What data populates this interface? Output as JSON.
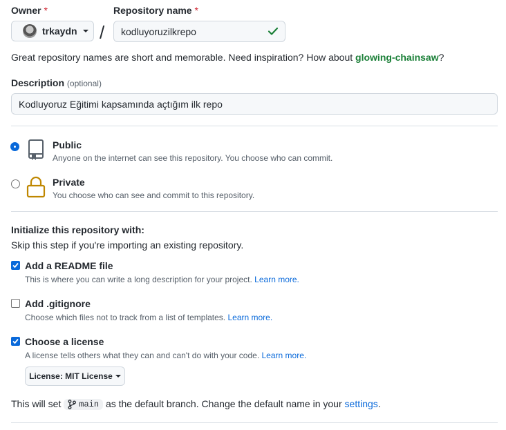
{
  "owner": {
    "label": "Owner",
    "required_mark": "*",
    "username": "trkaydn"
  },
  "repo": {
    "label": "Repository name",
    "required_mark": "*",
    "value": "kodluyoruzilkrepo",
    "separator": "/"
  },
  "name_hint": {
    "text": "Great repository names are short and memorable. Need inspiration? How about ",
    "suggestion": "glowing-chainsaw",
    "suffix": "?"
  },
  "description": {
    "label": "Description",
    "optional": "(optional)",
    "value": "Kodluyoruz Eğitimi kapsamında açtığım ilk repo"
  },
  "visibility": {
    "public": {
      "title": "Public",
      "desc": "Anyone on the internet can see this repository. You choose who can commit.",
      "selected": true
    },
    "private": {
      "title": "Private",
      "desc": "You choose who can see and commit to this repository.",
      "selected": false
    }
  },
  "init": {
    "heading": "Initialize this repository with:",
    "subheading": "Skip this step if you're importing an existing repository.",
    "readme": {
      "title": "Add a README file",
      "desc": "This is where you can write a long description for your project.",
      "link": "Learn more.",
      "checked": true
    },
    "gitignore": {
      "title": "Add .gitignore",
      "desc": "Choose which files not to track from a list of templates.",
      "link": "Learn more.",
      "checked": false
    },
    "license": {
      "title": "Choose a license",
      "desc": "A license tells others what they can and can't do with your code.",
      "link": "Learn more.",
      "checked": true,
      "button": "License: MIT License"
    }
  },
  "branch_note": {
    "prefix": "This will set",
    "branch": "main",
    "middle": "as the default branch. Change the default name in your",
    "link": "settings",
    "suffix": "."
  },
  "colors": {
    "accent": "#0969da",
    "success": "#1a7f37",
    "danger": "#cf222e",
    "lock": "#bf8700"
  }
}
